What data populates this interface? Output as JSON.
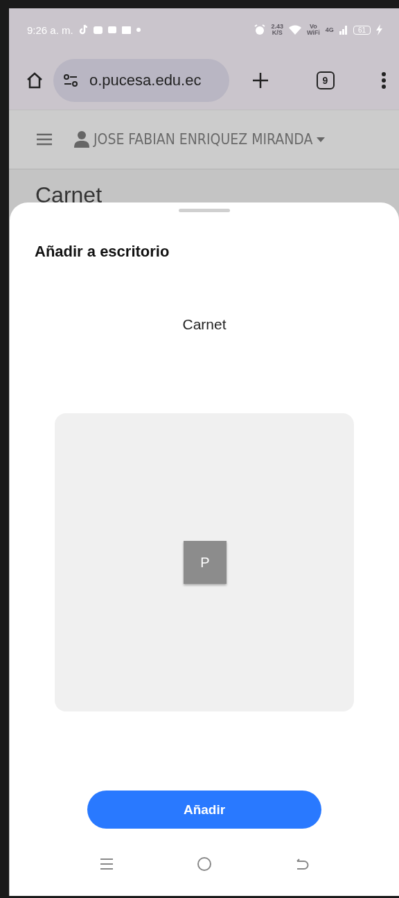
{
  "status_bar": {
    "time": "9:26 a. m.",
    "speed": "2.43",
    "speed_unit": "K/S",
    "vowifi": [
      "Vo",
      "WiFi"
    ],
    "network": "4G",
    "battery": "61"
  },
  "browser": {
    "url": "o.pucesa.edu.ec",
    "tab_count": "9"
  },
  "site_header": {
    "user": "JOSE FABIAN ENRIQUEZ MIRANDA"
  },
  "page_title": "Carnet",
  "sheet": {
    "title": "Añadir a escritorio",
    "app_name": "Carnet",
    "icon_letter": "P",
    "button": "Añadir"
  }
}
